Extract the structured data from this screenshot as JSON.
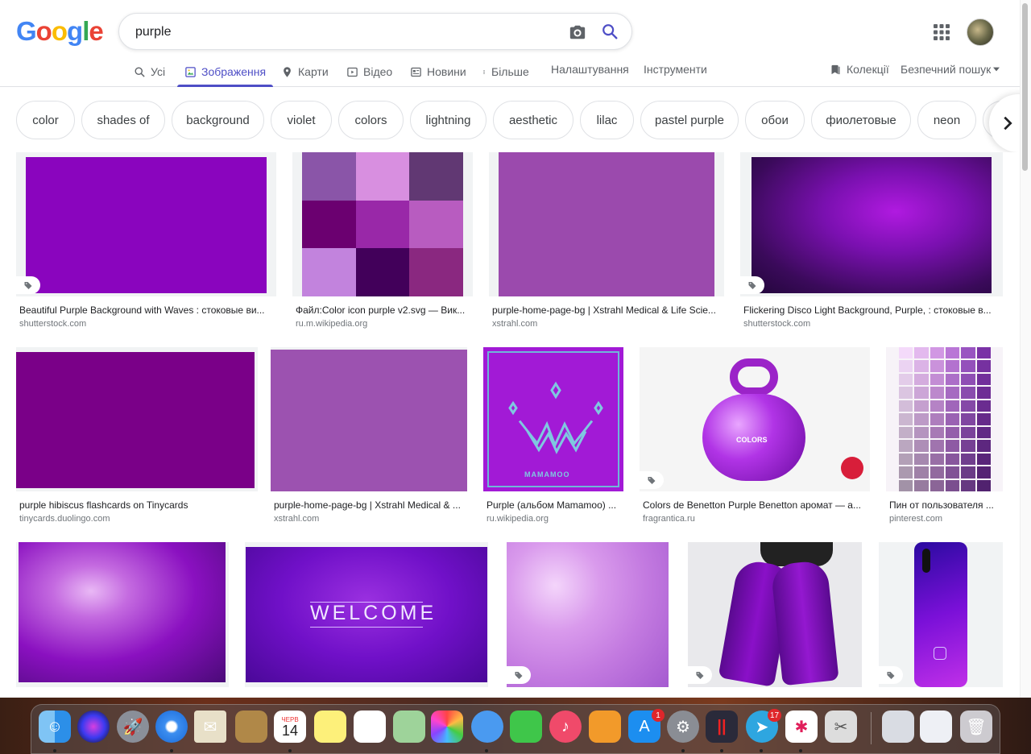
{
  "logo": {
    "letters": [
      "G",
      "o",
      "o",
      "g",
      "l",
      "e"
    ],
    "colors": [
      "#4285f4",
      "#ea4335",
      "#fbbc05",
      "#4285f4",
      "#34a853",
      "#ea4335"
    ]
  },
  "search": {
    "query": "purple"
  },
  "tabs": [
    {
      "label": "Усі",
      "icon": "search-icon"
    },
    {
      "label": "Зображення",
      "icon": "image-icon"
    },
    {
      "label": "Карти",
      "icon": "map-pin-icon"
    },
    {
      "label": "Відео",
      "icon": "video-icon"
    },
    {
      "label": "Новини",
      "icon": "news-icon"
    },
    {
      "label": "Більше",
      "icon": "more-vert-icon"
    }
  ],
  "tools": {
    "settings": "Налаштування",
    "tools": "Інструменти",
    "collections": "Колекції",
    "safe_search": "Безпечний пошук"
  },
  "chips": [
    "color",
    "shades of",
    "background",
    "violet",
    "colors",
    "lightning",
    "aesthetic",
    "lilac",
    "pastel purple",
    "обои",
    "фиолетовые",
    "neon"
  ],
  "results": [
    {
      "title": "Beautiful Purple Background with Waves : стоковые ви...",
      "source": "shutterstock.com"
    },
    {
      "title": "Файл:Color icon purple v2.svg — Вик...",
      "source": "ru.m.wikipedia.org"
    },
    {
      "title": "purple-home-page-bg | Xstrahl Medical & Life Scie...",
      "source": "xstrahl.com"
    },
    {
      "title": "Flickering Disco Light Background, Purple, : стоковые в...",
      "source": "shutterstock.com"
    },
    {
      "title": "purple hibiscus flashcards on Tinycards",
      "source": "tinycards.duolingo.com"
    },
    {
      "title": "purple-home-page-bg | Xstrahl Medical & ...",
      "source": "xstrahl.com"
    },
    {
      "title": "Purple (альбом Mamamoo) ...",
      "source": "ru.wikipedia.org"
    },
    {
      "title": "Colors de Benetton Purple Benetton аромат — а...",
      "source": "fragrantica.ru"
    },
    {
      "title": "Пин от пользователя ...",
      "source": "pinterest.com"
    }
  ],
  "image_text": {
    "welcome": "WELCOME",
    "mamamoo": "MAMAMOO",
    "colors": "COLORS"
  },
  "dock": {
    "calendar_month": "ЧЕРВ",
    "calendar_day": "14",
    "appstore_badge": "1",
    "telegram_badge": "17"
  }
}
